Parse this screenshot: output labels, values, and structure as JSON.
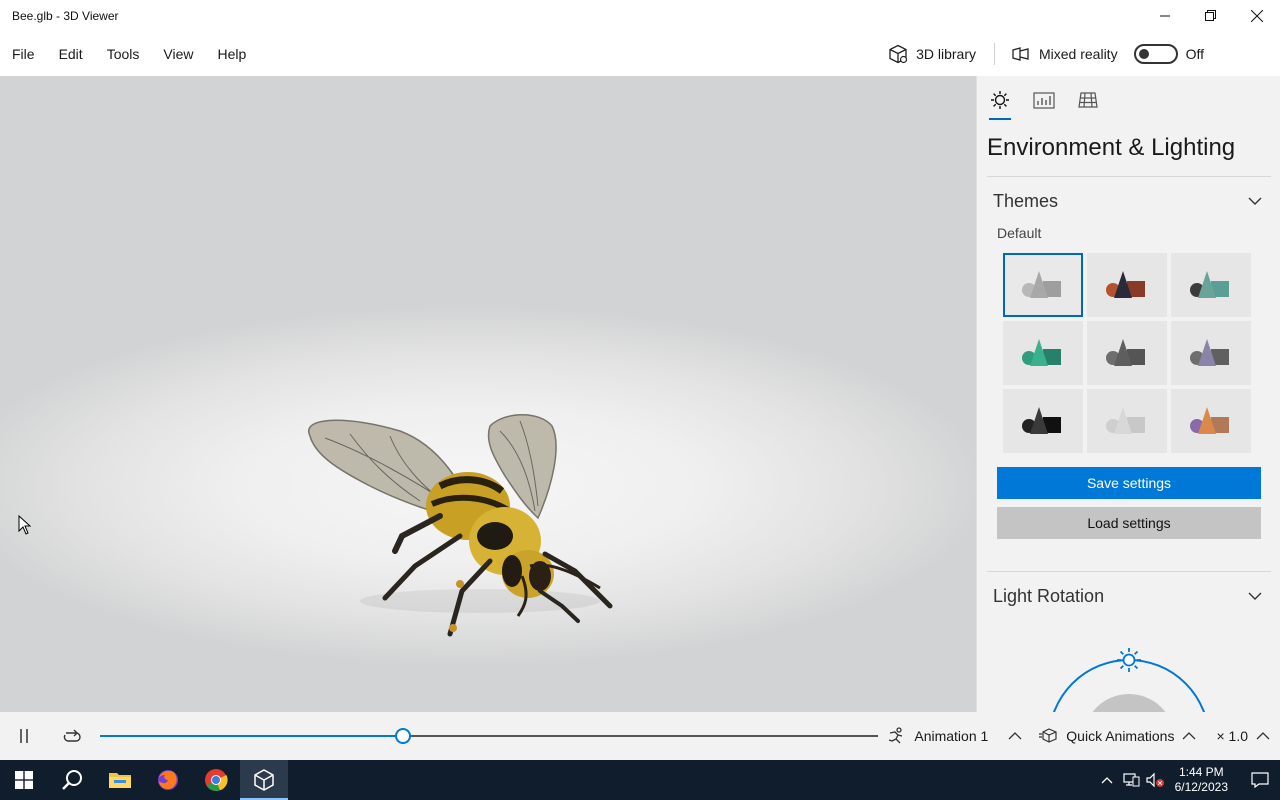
{
  "window": {
    "title": "Bee.glb - 3D Viewer",
    "controls": [
      "minimize",
      "maximize",
      "close"
    ]
  },
  "menu": {
    "items": [
      {
        "label": "File"
      },
      {
        "label": "Edit"
      },
      {
        "label": "Tools"
      },
      {
        "label": "View"
      },
      {
        "label": "Help"
      }
    ],
    "library_label": "3D library",
    "mixed_reality_label": "Mixed reality",
    "mixed_reality_state": "Off"
  },
  "panel": {
    "tabs": [
      {
        "name": "environment-lighting",
        "icon": "sun-icon",
        "active": true
      },
      {
        "name": "stats",
        "icon": "stats-chart-icon",
        "active": false
      },
      {
        "name": "grid",
        "icon": "grid-icon",
        "active": false
      }
    ],
    "title": "Environment & Lighting",
    "themes": {
      "label": "Themes",
      "sublabel": "Default",
      "items": [
        {
          "colors": [
            "#b8b8b8",
            "#a8a8a8",
            "#9e9e9e"
          ],
          "selected": true
        },
        {
          "colors": [
            "#b5522e",
            "#2a2a3a",
            "#8a3a2a"
          ],
          "selected": false
        },
        {
          "colors": [
            "#3c3c3c",
            "#6aa39a",
            "#5a9e95"
          ],
          "selected": false
        },
        {
          "colors": [
            "#2e9e7e",
            "#3bb08d",
            "#26806a"
          ],
          "selected": false
        },
        {
          "colors": [
            "#6e6e6e",
            "#5e5e5e",
            "#555555"
          ],
          "selected": false
        },
        {
          "colors": [
            "#6e6e6e",
            "#8a84a8",
            "#606060"
          ],
          "selected": false
        },
        {
          "colors": [
            "#222222",
            "#3a3a3a",
            "#111111"
          ],
          "selected": false
        },
        {
          "colors": [
            "#cfcfcf",
            "#d8d8d8",
            "#c8c8c8"
          ],
          "selected": false
        },
        {
          "colors": [
            "#8a6aa8",
            "#d98a4a",
            "#b07a5a"
          ],
          "selected": false
        }
      ]
    },
    "save_label": "Save settings",
    "load_label": "Load settings",
    "light_rotation_label": "Light Rotation"
  },
  "animation_bar": {
    "progress": 0.39,
    "animation_label": "Animation 1",
    "quick_animations_label": "Quick Animations",
    "speed_label": "× 1.0"
  },
  "taskbar": {
    "time": "1:44 PM",
    "date": "6/12/2023"
  },
  "colors": {
    "accent": "#0078d7",
    "taskbar": "#101d2c"
  }
}
